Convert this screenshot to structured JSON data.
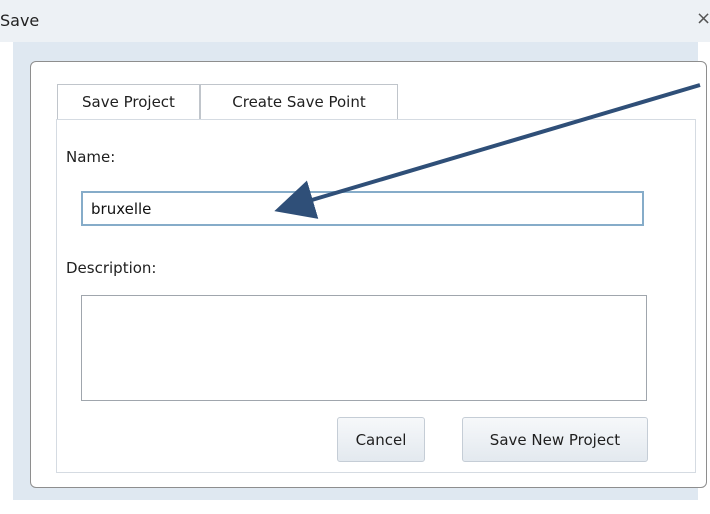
{
  "window": {
    "title": "Save",
    "close_glyph": "×"
  },
  "tabs": [
    {
      "label": "Save Project",
      "selected": true
    },
    {
      "label": "Create Save Point",
      "selected": false
    }
  ],
  "form": {
    "name_label": "Name:",
    "name_value": "bruxelle",
    "description_label": "Description:",
    "description_value": ""
  },
  "buttons": {
    "cancel_label": "Cancel",
    "save_new_label": "Save New Project"
  },
  "annotation": {
    "arrow_color": "#2f4f78"
  }
}
